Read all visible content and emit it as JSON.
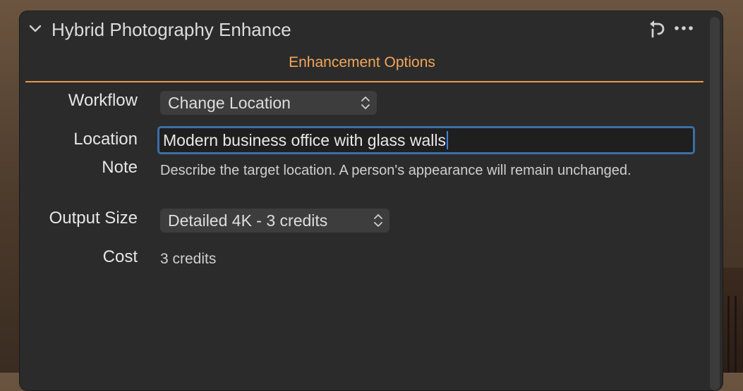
{
  "panel": {
    "title": "Hybrid Photography Enhance",
    "icons": [
      "chevron-down-icon",
      "reset-icon",
      "more-icon"
    ]
  },
  "section": {
    "title": "Enhancement Options",
    "accent_color": "#f2a65a"
  },
  "fields": {
    "workflow": {
      "label": "Workflow",
      "value": "Change Location"
    },
    "location": {
      "label": "Location",
      "value": "Modern business office with glass walls"
    },
    "note": {
      "label": "Note",
      "text": "Describe the target location. A person's appearance will remain unchanged."
    },
    "output_size": {
      "label": "Output Size",
      "value": "Detailed 4K - 3 credits"
    },
    "cost": {
      "label": "Cost",
      "value": "3 credits"
    }
  }
}
